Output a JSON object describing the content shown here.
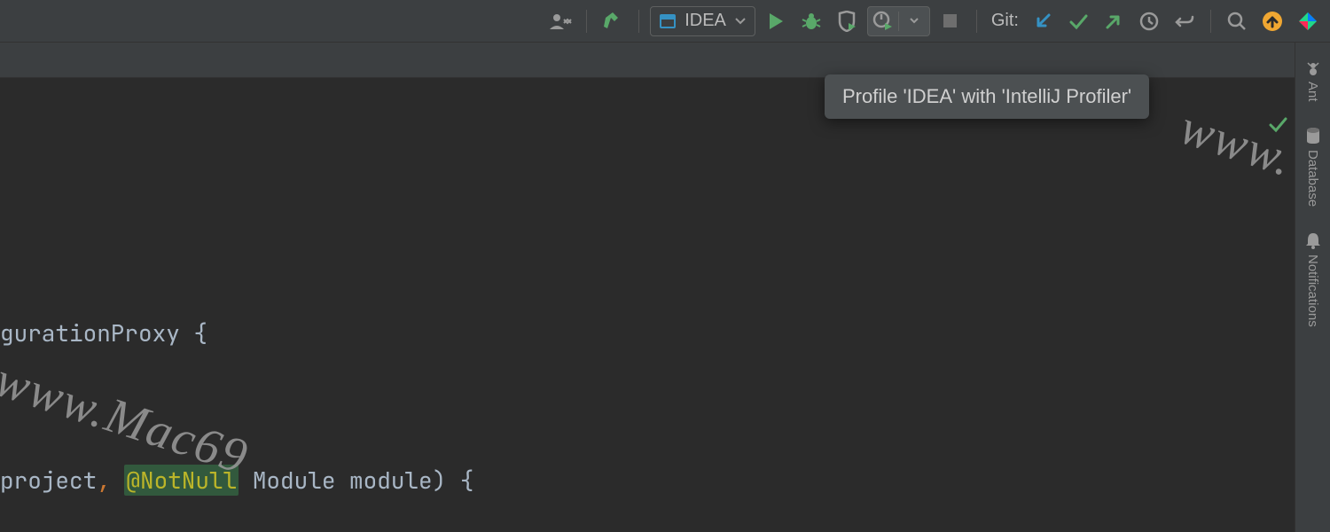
{
  "toolbar": {
    "run_config_label": "IDEA",
    "git_label": "Git:"
  },
  "tooltip": {
    "text": "Profile 'IDEA' with 'IntelliJ Profiler'"
  },
  "right_strip": {
    "items": [
      {
        "label": "Ant"
      },
      {
        "label": "Database"
      },
      {
        "label": "Notifications"
      }
    ]
  },
  "code": {
    "line1": "gurationProxy {",
    "line2_a": "project",
    "line2_b": ", ",
    "line2_c": "@NotNull",
    "line2_d": " Module ",
    "line2_e": "module",
    "line2_f": ") {"
  },
  "watermark": {
    "text1": "www.",
    "text2": "www.Mac69"
  },
  "colors": {
    "bg_chrome": "#3c3f41",
    "bg_editor": "#2b2b2b",
    "accent_green": "#59a869",
    "accent_blue": "#3592c4",
    "accent_orange": "#f0a732"
  }
}
